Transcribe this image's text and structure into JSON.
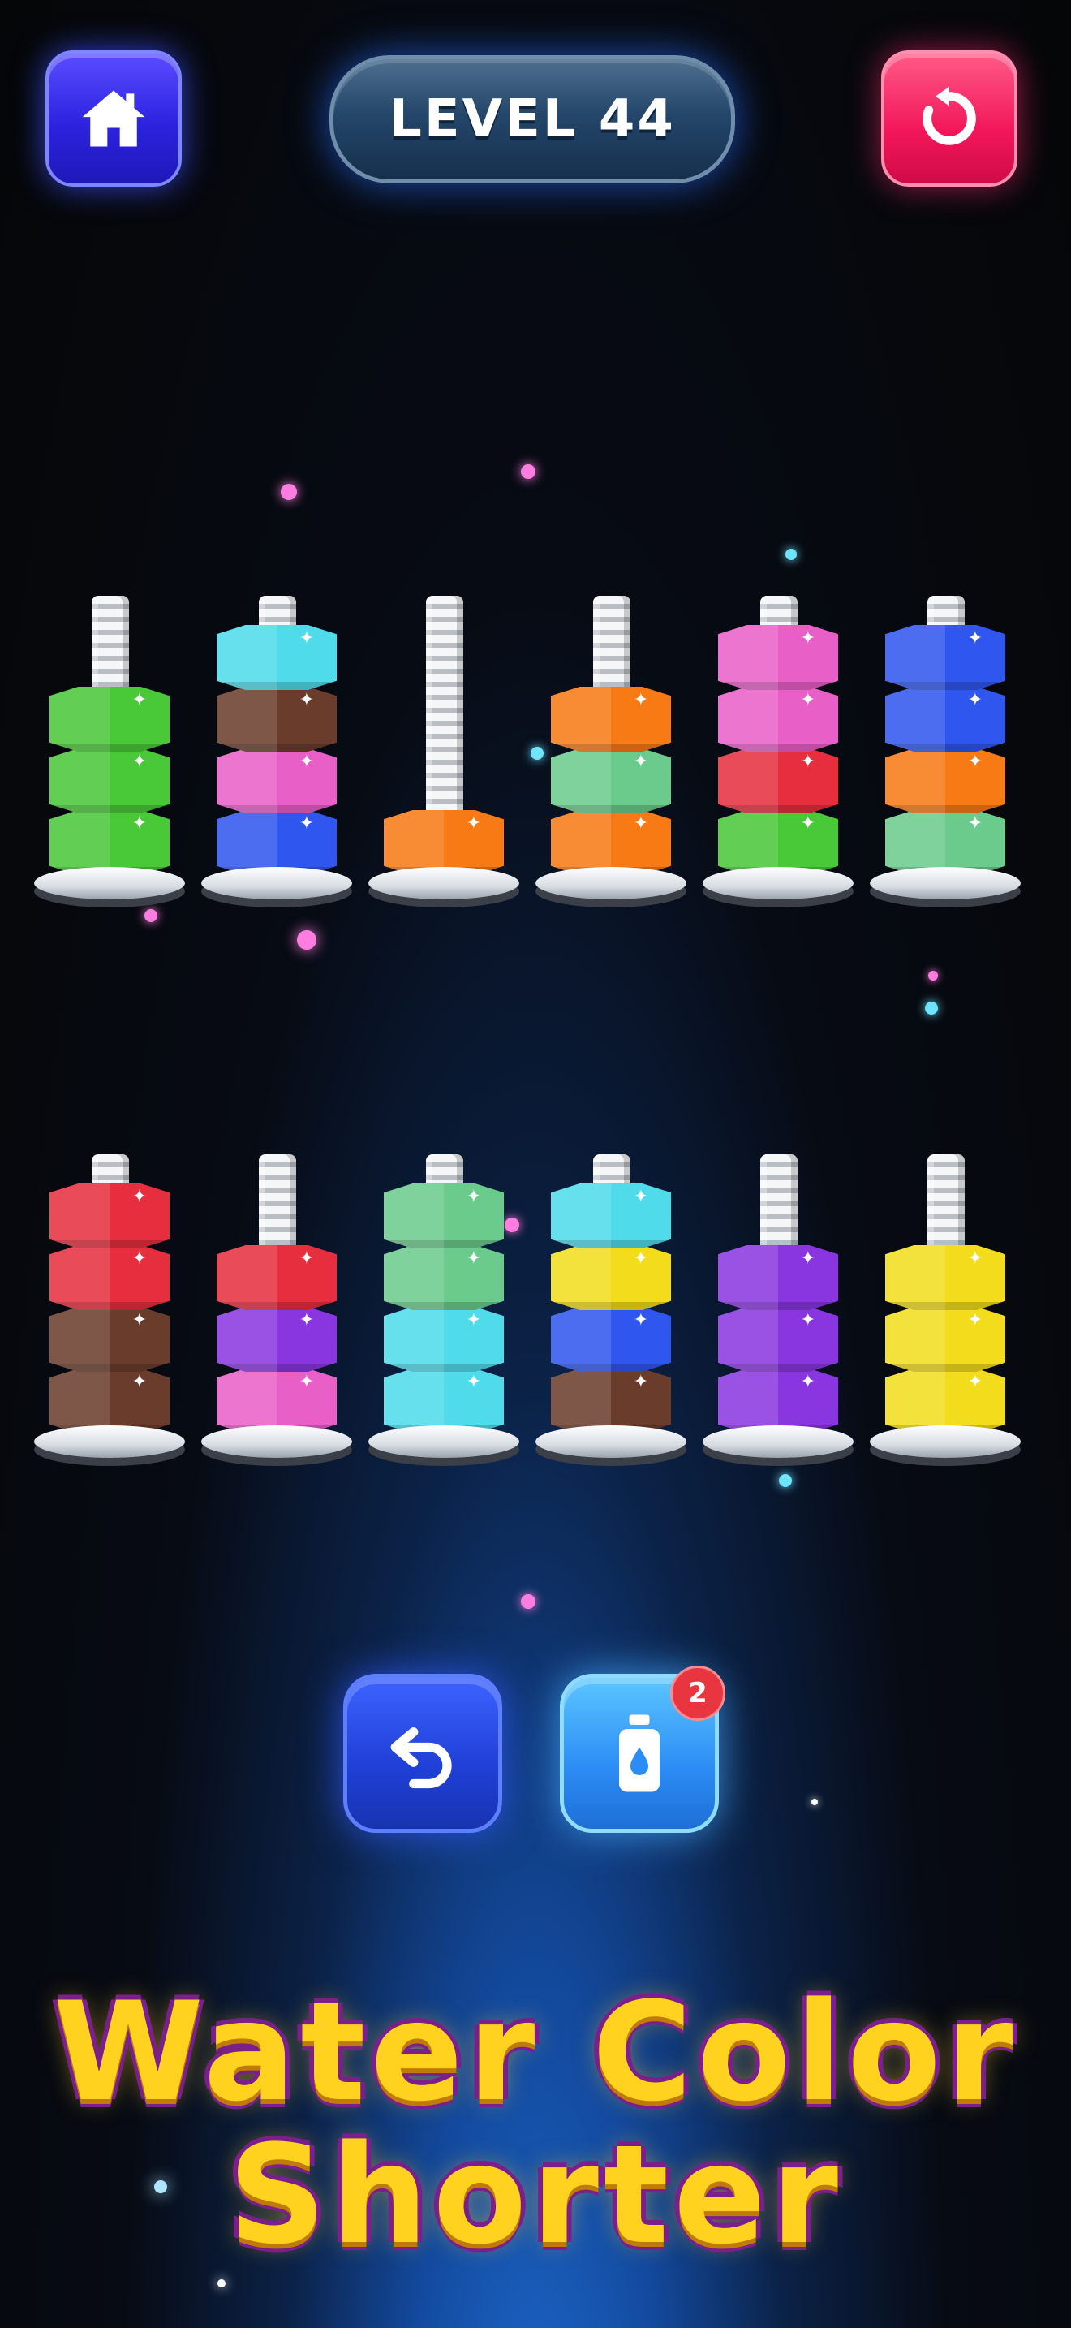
{
  "header": {
    "level_label": "LEVEL 44",
    "home_icon": "home-icon",
    "restart_icon": "restart-icon"
  },
  "colors": {
    "green": "#49c838",
    "brown": "#6a3c2c",
    "pink": "#e85fc7",
    "blue": "#2f56ee",
    "cyan": "#4fdbea",
    "orange": "#f77a14",
    "mint": "#6bcb8c",
    "red": "#e62e3e",
    "purple": "#8a36e0",
    "yellow": "#f2dc1c"
  },
  "racks": [
    {
      "stack_bottom_to_top": [
        "green",
        "green",
        "green"
      ]
    },
    {
      "stack_bottom_to_top": [
        "blue",
        "pink",
        "brown",
        "cyan"
      ]
    },
    {
      "stack_bottom_to_top": [
        "orange"
      ]
    },
    {
      "stack_bottom_to_top": [
        "orange",
        "mint",
        "orange"
      ]
    },
    {
      "stack_bottom_to_top": [
        "green",
        "red",
        "pink",
        "pink"
      ]
    },
    {
      "stack_bottom_to_top": [
        "mint",
        "orange",
        "blue",
        "blue"
      ]
    },
    {
      "stack_bottom_to_top": [
        "brown",
        "brown",
        "red",
        "red"
      ]
    },
    {
      "stack_bottom_to_top": [
        "pink",
        "purple",
        "red"
      ]
    },
    {
      "stack_bottom_to_top": [
        "cyan",
        "cyan",
        "mint",
        "mint"
      ]
    },
    {
      "stack_bottom_to_top": [
        "brown",
        "blue",
        "yellow",
        "cyan"
      ]
    },
    {
      "stack_bottom_to_top": [
        "purple",
        "purple",
        "purple"
      ]
    },
    {
      "stack_bottom_to_top": [
        "yellow",
        "yellow",
        "yellow"
      ]
    }
  ],
  "capacity": 4,
  "controls": {
    "undo_icon": "undo-icon",
    "bottle_icon": "bottle-icon",
    "bottle_badge_count": "2"
  },
  "title": {
    "line1": "Water Color",
    "line2": "Shorter"
  }
}
